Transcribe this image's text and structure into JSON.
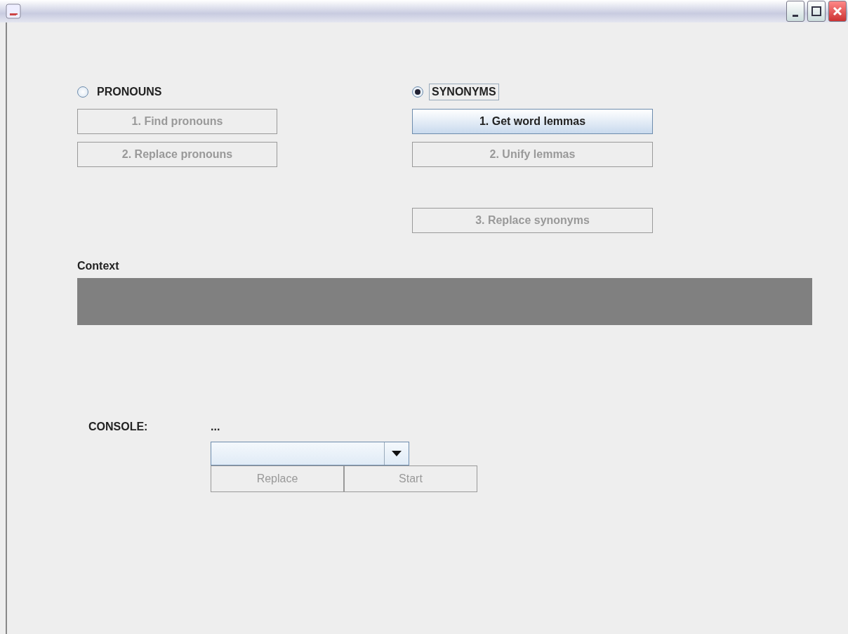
{
  "modes": [
    {
      "label": "PRONOUNS",
      "selected": false,
      "focused": false,
      "steps": [
        {
          "label": "1. Find pronouns",
          "disabled": true
        },
        {
          "label": "2. Replace pronouns",
          "disabled": true
        }
      ]
    },
    {
      "label": "SYNONYMS",
      "selected": true,
      "focused": true,
      "steps": [
        {
          "label": "1. Get word lemmas",
          "disabled": false
        },
        {
          "label": "2. Unify lemmas",
          "disabled": true
        },
        {
          "label": "3. Replace synonyms",
          "disabled": true
        }
      ]
    }
  ],
  "context": {
    "label": "Context"
  },
  "console": {
    "label": "CONSOLE:",
    "output": "...",
    "buttons": [
      {
        "label": "Replace",
        "disabled": true
      },
      {
        "label": "Start",
        "disabled": true
      }
    ]
  }
}
